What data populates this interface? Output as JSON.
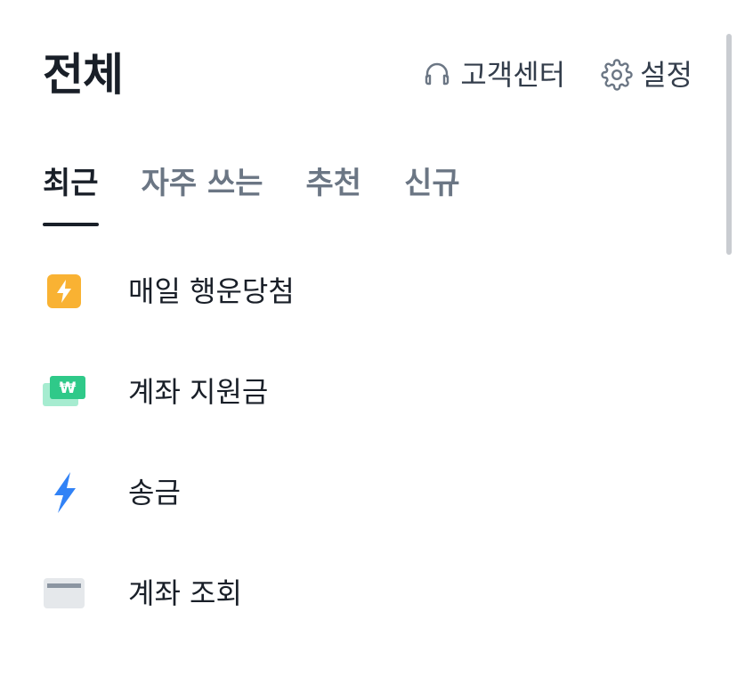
{
  "header": {
    "title": "전체",
    "actions": [
      {
        "label": "고객센터",
        "icon": "headset-icon"
      },
      {
        "label": "설정",
        "icon": "gear-icon"
      }
    ]
  },
  "tabs": [
    {
      "label": "최근",
      "active": true
    },
    {
      "label": "자주 쓰는",
      "active": false
    },
    {
      "label": "추천",
      "active": false
    },
    {
      "label": "신규",
      "active": false
    }
  ],
  "list": {
    "items": [
      {
        "label": "매일 행운당첨",
        "icon": "lightning-badge-icon",
        "color": "#f9b233"
      },
      {
        "label": "계좌 지원금",
        "icon": "won-card-icon",
        "color": "#2fc989"
      },
      {
        "label": "송금",
        "icon": "lightning-icon",
        "color": "#3182f6"
      },
      {
        "label": "계좌 조회",
        "icon": "card-icon",
        "color": "#dee2e6"
      }
    ]
  },
  "colors": {
    "text_primary": "#191f28",
    "text_secondary": "#6b7684",
    "accent_blue": "#3182f6",
    "accent_yellow": "#f9b233",
    "accent_green": "#2fc989"
  }
}
